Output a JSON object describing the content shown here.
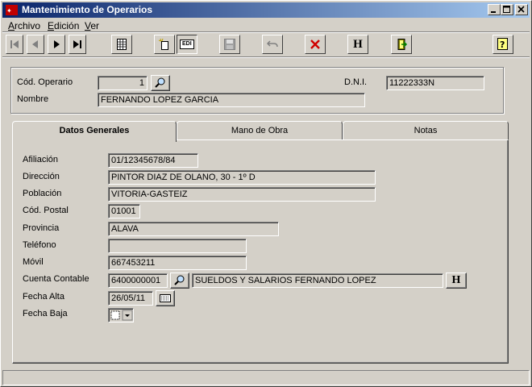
{
  "window": {
    "title": "Mantenimiento de Operarios"
  },
  "menu": {
    "archivo_ul": "A",
    "archivo_rest": "rchivo",
    "edicion_ul": "E",
    "edicion_rest": "dición",
    "ver_ul": "V",
    "ver_rest": "er"
  },
  "toolbar": {
    "edit_label": "EDI",
    "help_label": "H"
  },
  "header": {
    "cod_operario_label": "Cód. Operario",
    "cod_operario_value": "1",
    "dni_label": "D.N.I.",
    "dni_value": "11222333N",
    "nombre_label": "Nombre",
    "nombre_value": "FERNANDO LOPEZ GARCIA"
  },
  "tabs": [
    {
      "label": "Datos Generales"
    },
    {
      "label": "Mano de Obra"
    },
    {
      "label": "Notas"
    }
  ],
  "form": {
    "afiliacion_label": "Afiliación",
    "afiliacion_value": "01/12345678/84",
    "direccion_label": "Dirección",
    "direccion_value": "PINTOR DIAZ DE OLANO, 30 - 1º D",
    "poblacion_label": "Población",
    "poblacion_value": "VITORIA-GASTEIZ",
    "cod_postal_label": "Cód. Postal",
    "cod_postal_value": "01001",
    "provincia_label": "Provincia",
    "provincia_value": "ALAVA",
    "telefono_label": "Teléfono",
    "telefono_value": "",
    "movil_label": "Móvil",
    "movil_value": "667453211",
    "cuenta_label": "Cuenta Contable",
    "cuenta_value": "6400000001",
    "cuenta_desc": "SUELDOS Y SALARIOS FERNANDO LOPEZ",
    "cuenta_h": "H",
    "fecha_alta_label": "Fecha Alta",
    "fecha_alta_value": "26/05/11",
    "fecha_baja_label": "Fecha Baja"
  }
}
